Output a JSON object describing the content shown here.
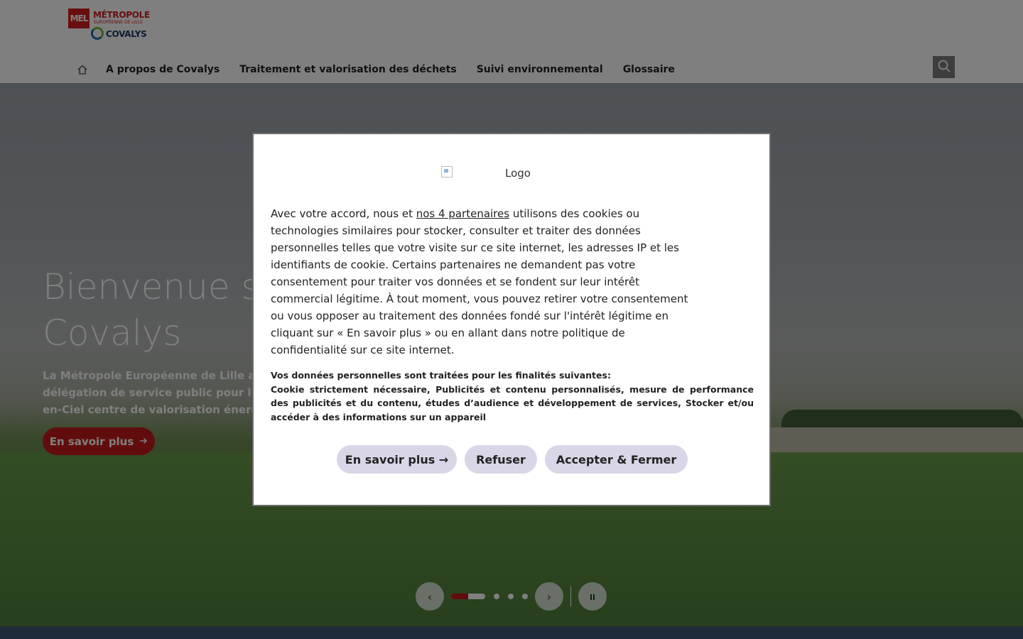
{
  "header": {
    "logo": {
      "mel": "MEL",
      "metropole": "MÉTROPOLE",
      "europeenne": "EUROPÉENNE DE LILLE",
      "covalys": "COVALYS"
    },
    "nav": [
      {
        "label": "A propos de Covalys"
      },
      {
        "label": "Traitement et valorisation des déchets"
      },
      {
        "label": "Suivi environnemental"
      },
      {
        "label": "Glossaire"
      }
    ],
    "icons": {
      "home": "home-icon",
      "search": "search-icon"
    }
  },
  "hero": {
    "title": "Bienvenue sur Covalys",
    "text": "La Métropole Européenne de Lille a confié la délégation de service public pour l'exploitation d'Arc-en-Ciel centre de valorisation énergétique (CVE).",
    "cta": "En savoir plus"
  },
  "carousel": {
    "slides": 4,
    "active": 1
  },
  "consent": {
    "logo_alt": "Logo",
    "text_before_link": "Avec votre accord, nous et ",
    "partners_link": "nos 4 partenaires",
    "text_after_link": " utilisons des cookies ou technologies similaires pour stocker, consulter et traiter des données personnelles telles que votre visite sur ce site internet, les adresses IP et les identifiants de cookie. Certains partenaires ne demandent pas votre consentement pour traiter vos données et se fondent sur leur intérêt commercial légitime. À tout moment, vous pouvez retirer votre consentement ou vous opposer au traitement des données fondé sur l'intérêt légitime en cliquant sur « En savoir plus » ou en allant dans notre politique de confidentialité sur ce site internet.",
    "purposes_title": "Vos données personnelles sont traitées pour les finalités suivantes:",
    "purposes_list": "Cookie strictement nécessaire, Publicités et contenu personnalisés, mesure de performance des publicités et du contenu, études d’audience et développement de services, Stocker et/ou accéder à des informations sur un appareil",
    "btn_more": "En savoir plus →",
    "btn_refuse": "Refuser",
    "btn_accept": "Accepter & Fermer"
  },
  "colors": {
    "accent": "#c41a1a",
    "button_bg": "#d9d6e8",
    "overlay": "rgba(0,0,0,0.5)"
  }
}
